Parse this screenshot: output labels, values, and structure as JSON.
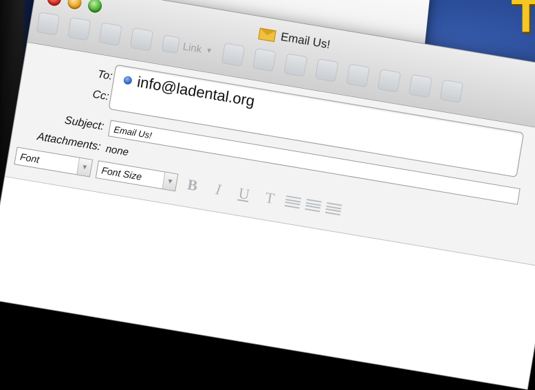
{
  "window": {
    "title": "Email Us!",
    "toolbar": {
      "link_label": "Link"
    }
  },
  "form": {
    "to_label": "To:",
    "cc_label": "Cc:",
    "to_address": "info@ladental.org",
    "subject_label": "Subject:",
    "subject_value": "Email Us!",
    "attachments_label": "Attachments:",
    "attachments_value": "none"
  },
  "format_bar": {
    "font_select": "Font",
    "font_size_select": "Font Size",
    "bold": "B",
    "italic": "I",
    "underline": "U",
    "text": "T"
  },
  "colors": {
    "heading_yellow": "#f6c623",
    "background_blue": "#1c3a80"
  }
}
